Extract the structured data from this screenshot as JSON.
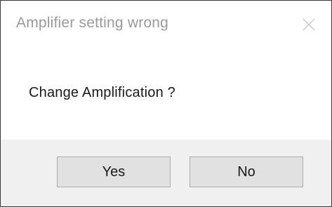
{
  "dialog": {
    "title": "Amplifier setting wrong",
    "close_icon": "close-icon",
    "message": "Change Amplification ?",
    "buttons": {
      "yes_label": "Yes",
      "no_label": "No"
    }
  },
  "colors": {
    "title_text": "#9a9a9a",
    "message_text": "#1a1a1a",
    "footer_bg": "#f0f0f0",
    "button_bg": "#e1e1e1",
    "button_border": "#adadad",
    "dialog_border": "#3a3a3a"
  }
}
